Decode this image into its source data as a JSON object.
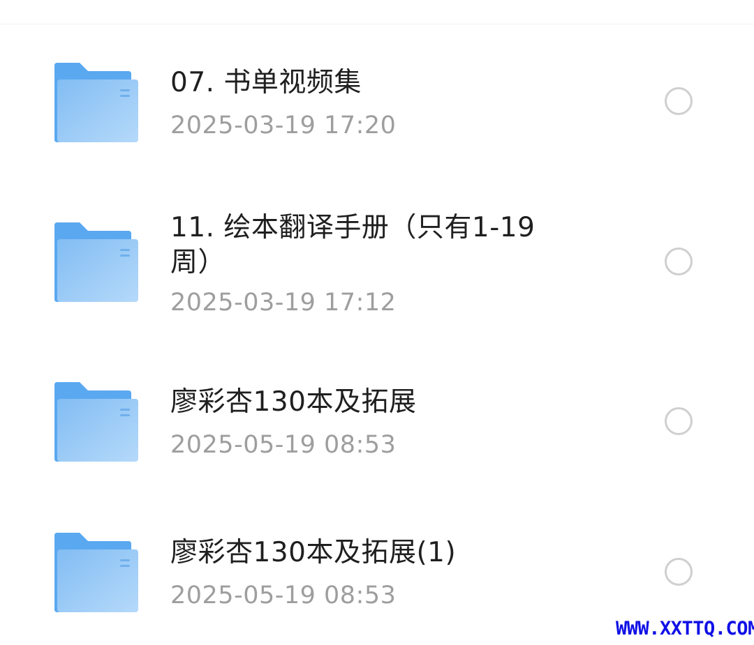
{
  "files": [
    {
      "name": "07. 书单视频集",
      "date": "2025-03-19 17:20",
      "icon": "folder-icon"
    },
    {
      "name": "11. 绘本翻译手册（只有1-19\n周）",
      "date": "2025-03-19 17:12",
      "icon": "folder-icon"
    },
    {
      "name": "廖彩杏130本及拓展",
      "date": "2025-05-19 08:53",
      "icon": "folder-icon"
    },
    {
      "name": "廖彩杏130本及拓展(1)",
      "date": "2025-05-19 08:53",
      "icon": "folder-icon"
    }
  ],
  "watermark": "WWW.XXTTQ.COM",
  "colors": {
    "folder_back": "#5aa8f0",
    "folder_front": "#8cc4f5",
    "name_text": "#1f1f1f",
    "date_text": "#9e9e9e",
    "checkbox_border": "#cfcfcf",
    "watermark": "#1010e6"
  }
}
